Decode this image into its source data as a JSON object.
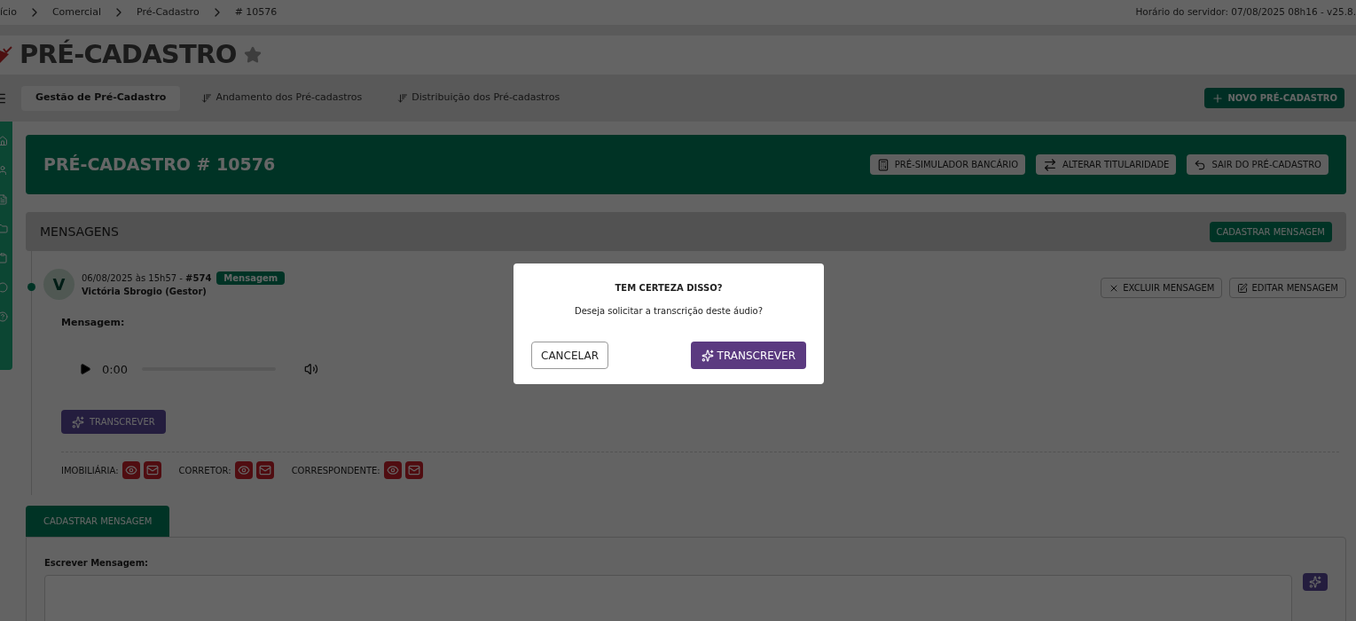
{
  "breadcrumb": [
    "ício",
    "Comercial",
    "Pré-Cadastro",
    "# 10576"
  ],
  "server_time": "Horário do servidor: 07/08/2025 08h16 - v25.8.",
  "page_title": "PRÉ-CADASTRO",
  "tabs": [
    {
      "label": "Gestão de Pré-Cadastro",
      "selected": true
    },
    {
      "label": "Andamento dos Pré-cadastros",
      "selected": false
    },
    {
      "label": "Distribuição dos Pré-cadastros",
      "selected": false
    }
  ],
  "new_button": "NOVO PRÉ-CADASTRO",
  "record_title": "PRÉ-CADASTRO # 10576",
  "header_buttons": [
    {
      "label": "PRÉ-SIMULADOR BANCÁRIO",
      "kind": "calculator"
    },
    {
      "label": "ALTERAR TITULARIDADE",
      "kind": "swap"
    },
    {
      "label": "SAIR DO PRÉ-CADASTRO",
      "kind": "exit"
    }
  ],
  "messages": {
    "title": "MENSAGENS",
    "add_button": "CADASTRAR MENSAGEM"
  },
  "message": {
    "avatar": "V",
    "meta": "06/08/2025 às 15h57 - **#574**",
    "badge": "Mensagem",
    "author": "Victória Sbrogio (Gestor)",
    "actions": [
      {
        "label": "EXCLUIR MENSAGEM",
        "kind": "delete"
      },
      {
        "label": "EDITAR MENSAGEM",
        "kind": "edit"
      }
    ],
    "label": "Mensagem:",
    "audio": {
      "time": "0:00"
    },
    "transcribe": "TRANSCREVER",
    "recipients": [
      {
        "label": "IMOBILIÁRIA:"
      },
      {
        "label": "CORRETOR:"
      },
      {
        "label": "CORRESPONDENTE:"
      }
    ]
  },
  "compose": {
    "tab": "CADASTRAR MENSAGEM",
    "label": "Escrever Mensagem:"
  },
  "dialog": {
    "title": "TEM CERTEZA DISSO?",
    "text": "Deseja solicitar a transcrição deste áudio?",
    "cancel": "CANCELAR",
    "confirm": "TRANSCREVER"
  }
}
